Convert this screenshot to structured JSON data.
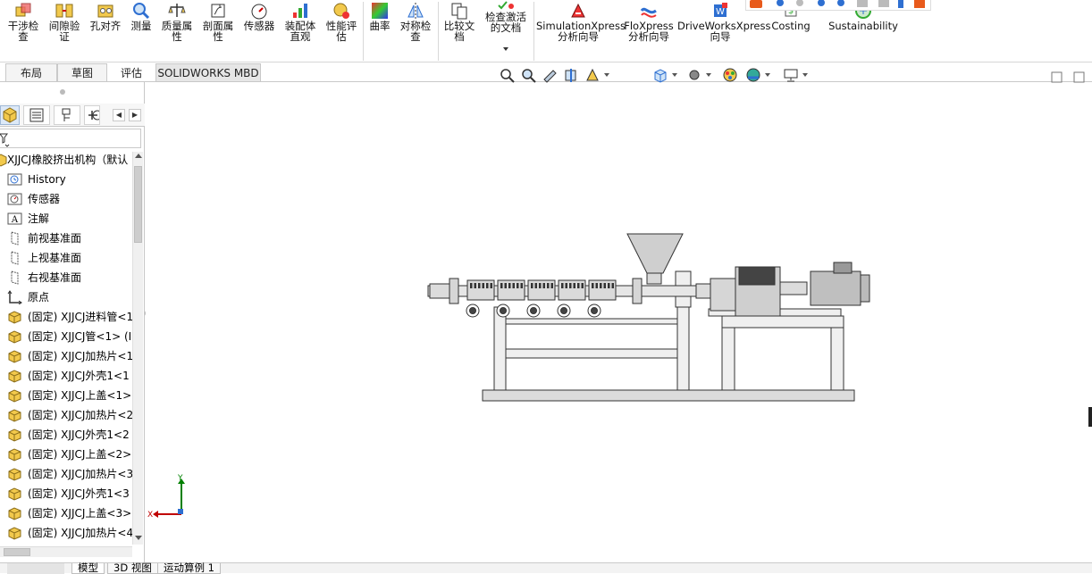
{
  "ribbon": {
    "items": [
      {
        "label": "干涉检\n查",
        "icon": "interference-icon"
      },
      {
        "label": "间隙验\n证",
        "icon": "clearance-icon"
      },
      {
        "label": "孔对齐",
        "icon": "hole-alignment-icon"
      },
      {
        "label": "测量",
        "icon": "measure-icon"
      },
      {
        "label": "质量属\n性",
        "icon": "mass-properties-icon"
      },
      {
        "label": "剖面属\n性",
        "icon": "section-properties-icon"
      },
      {
        "label": "传感器",
        "icon": "sensor-icon"
      },
      {
        "label": "装配体\n直观",
        "icon": "assembly-visualization-icon"
      },
      {
        "label": "性能评\n估",
        "icon": "performance-evaluation-icon"
      },
      {
        "label": "曲率",
        "icon": "curvature-icon"
      },
      {
        "label": "对称检\n查",
        "icon": "symmetry-check-icon"
      },
      {
        "label": "比较文\n档",
        "icon": "compare-documents-icon"
      },
      {
        "label": "检查激活\n的文档",
        "icon": "check-active-document-icon"
      },
      {
        "label": "SimulationXpress\n分析向导",
        "icon": "simulationxpress-icon"
      },
      {
        "label": "FloXpress\n分析向导",
        "icon": "floxpress-icon"
      },
      {
        "label": "DriveWorksXpress\n向导",
        "icon": "driveworksxpress-icon"
      },
      {
        "label": "Costing",
        "icon": "costing-icon"
      },
      {
        "label": "Sustainability",
        "icon": "sustainability-icon"
      }
    ]
  },
  "command_tabs": [
    {
      "label": "布局"
    },
    {
      "label": "草图"
    },
    {
      "label": "评估"
    },
    {
      "label": "SOLIDWORKS MBD"
    }
  ],
  "feature_tree": {
    "root": "XJJCJ橡胶挤出机构（默认",
    "items": [
      {
        "label": "History",
        "icon": "history-icon"
      },
      {
        "label": "传感器",
        "icon": "sensor-folder-icon"
      },
      {
        "label": "注解",
        "icon": "annotation-icon"
      },
      {
        "label": "前视基准面",
        "icon": "plane-icon"
      },
      {
        "label": "上视基准面",
        "icon": "plane-icon"
      },
      {
        "label": "右视基准面",
        "icon": "plane-icon"
      },
      {
        "label": "原点",
        "icon": "origin-icon"
      },
      {
        "label": "(固定) XJJCJ进料管<1",
        "icon": "part-icon"
      },
      {
        "label": "(固定) XJJCJ管<1> (I",
        "icon": "part-icon"
      },
      {
        "label": "(固定) XJJCJ加热片<1",
        "icon": "part-icon"
      },
      {
        "label": "(固定) XJJCJ外壳1<1",
        "icon": "part-icon"
      },
      {
        "label": "(固定) XJJCJ上盖<1>",
        "icon": "part-icon"
      },
      {
        "label": "(固定) XJJCJ加热片<2",
        "icon": "part-icon"
      },
      {
        "label": "(固定) XJJCJ外壳1<2",
        "icon": "part-icon"
      },
      {
        "label": "(固定) XJJCJ上盖<2>",
        "icon": "part-icon"
      },
      {
        "label": "(固定) XJJCJ加热片<3",
        "icon": "part-icon"
      },
      {
        "label": "(固定) XJJCJ外壳1<3",
        "icon": "part-icon"
      },
      {
        "label": "(固定) XJJCJ上盖<3>",
        "icon": "part-icon"
      },
      {
        "label": "(固定) XJJCJ加热片<4",
        "icon": "part-icon"
      }
    ]
  },
  "bottom_tabs": [
    {
      "label": "模型"
    },
    {
      "label": "3D 视图"
    },
    {
      "label": "运动算例 1"
    }
  ],
  "triad": {
    "x": "X",
    "y": "Y"
  },
  "colors": {
    "accent": "#2e6fd1",
    "triad_x": "#c00000",
    "triad_y": "#008000"
  }
}
